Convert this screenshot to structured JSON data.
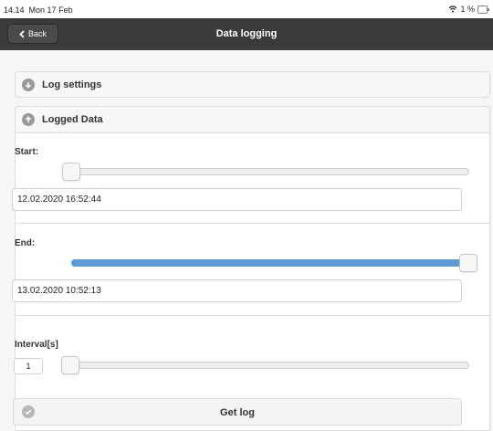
{
  "status_bar": {
    "time": "14.14",
    "date": "Mon 17 Feb",
    "battery": "1 %"
  },
  "nav": {
    "back_label": "Back",
    "title": "Data logging"
  },
  "sections": {
    "log_settings": "Log settings",
    "logged_data": "Logged Data"
  },
  "start": {
    "label": "Start:",
    "value": "12.02.2020 16:52:44",
    "slider_fraction": 0.0
  },
  "end": {
    "label": "End:",
    "value": "13.02.2020 10:52:13",
    "slider_fraction": 1.0
  },
  "interval": {
    "label": "Interval[s]",
    "value": "1",
    "slider_fraction": 0.0
  },
  "get_log_label": "Get log",
  "colors": {
    "navbar": "#3b3b3b",
    "slider_fill": "#5b9bd5",
    "icon_gray": "#9b9b9b"
  }
}
